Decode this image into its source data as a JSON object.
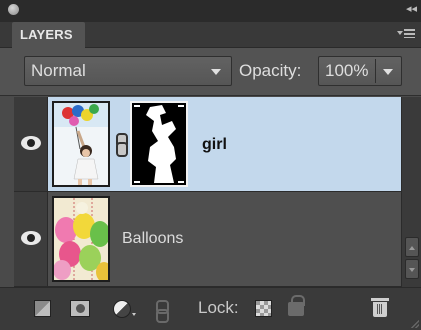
{
  "panel": {
    "tab_label": "LAYERS"
  },
  "options": {
    "blend_mode": "Normal",
    "opacity_label": "Opacity:",
    "opacity_value": "100%"
  },
  "layers": [
    {
      "name": "girl",
      "selected": true,
      "visible": true,
      "has_mask": true
    },
    {
      "name": "Balloons",
      "selected": false,
      "visible": true,
      "has_mask": false
    }
  ],
  "toolbar": {
    "lock_label": "Lock:"
  },
  "colors": {
    "selected_row": "#c3d8ec",
    "panel_bg": "#535353"
  },
  "icons": [
    "close-icon",
    "collapse-icon",
    "panel-menu-icon",
    "chevron-down-icon",
    "eye-icon",
    "link-icon",
    "new-layer-icon",
    "layer-mask-icon",
    "adjustment-layer-icon",
    "lock-transparent-icon",
    "lock-all-icon",
    "trash-icon"
  ]
}
